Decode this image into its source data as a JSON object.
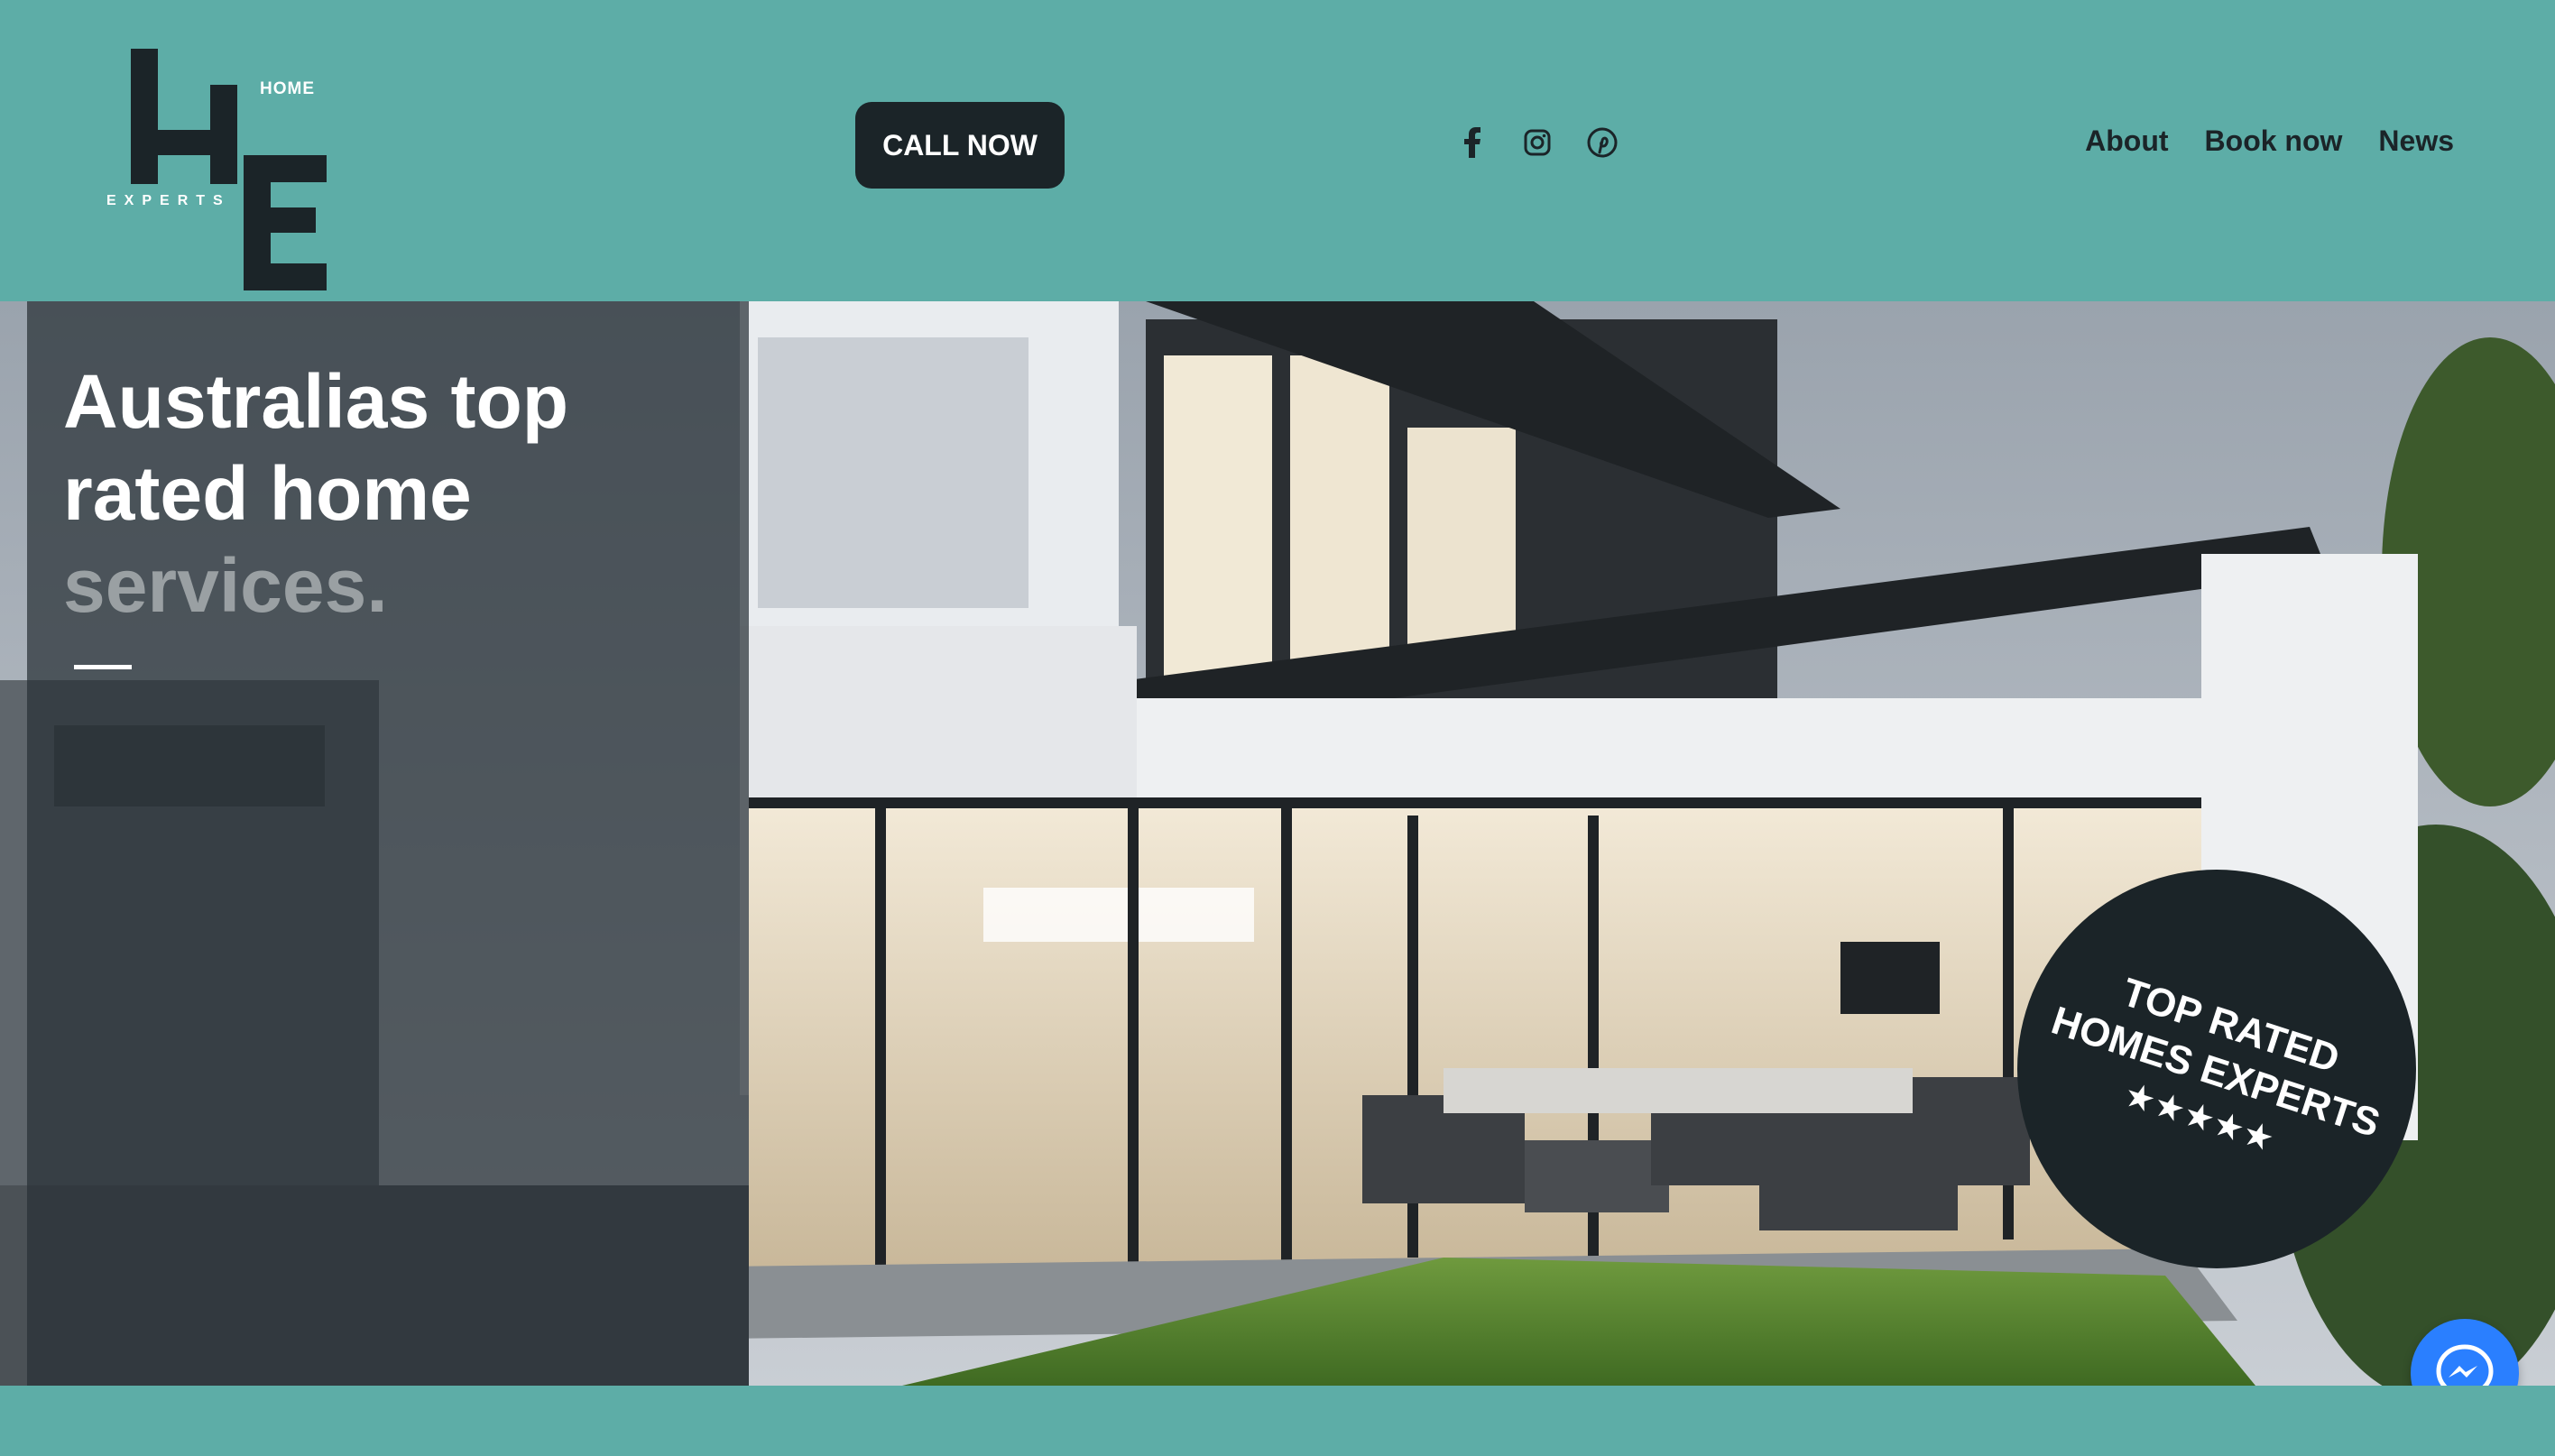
{
  "header": {
    "logo": {
      "top_text": "HOME",
      "bottom_text": "EXPERTS"
    },
    "call_button_label": "CALL NOW",
    "social": [
      "facebook-icon",
      "instagram-icon",
      "pinterest-icon"
    ],
    "nav": [
      {
        "label": "About"
      },
      {
        "label": "Book now"
      },
      {
        "label": "News"
      }
    ]
  },
  "hero": {
    "headline_line1": "Australias top",
    "headline_line2": "rated home",
    "headline_line3": "services.",
    "badge": {
      "line1": "TOP RATED",
      "line2": "HOMES EXPERTS",
      "stars": "★★★★★"
    }
  },
  "colors": {
    "brand_teal": "#5dada7",
    "dark": "#1b2428",
    "messenger_blue": "#2a7fff"
  }
}
